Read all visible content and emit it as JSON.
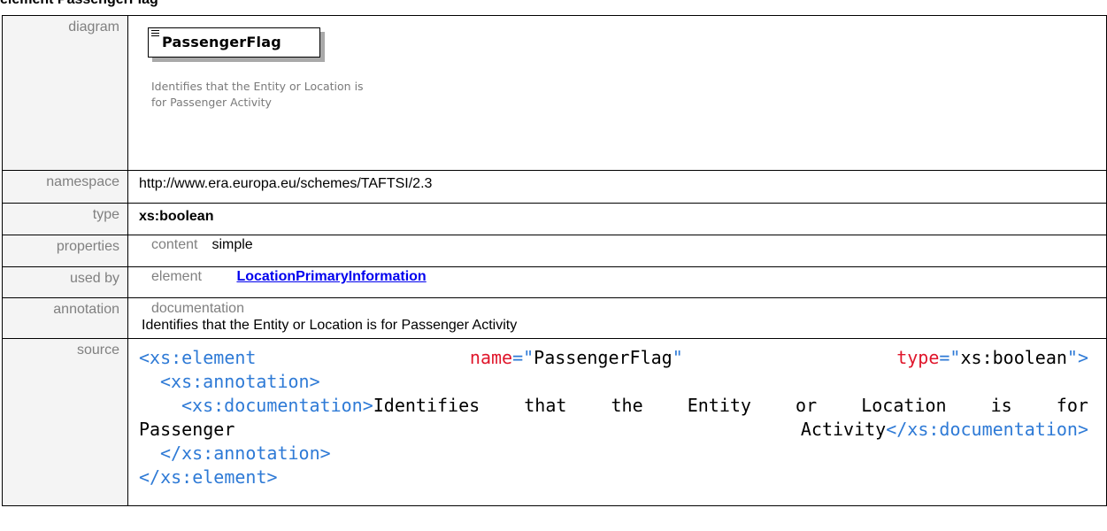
{
  "heading": "element PassengerFlag",
  "diagram": {
    "label": "diagram",
    "element_name": "PassengerFlag",
    "element_doc": "Identifies that the Entity or Location is for Passenger Activity"
  },
  "namespace": {
    "label": "namespace",
    "value": "http://www.era.europa.eu/schemes/TAFTSI/2.3"
  },
  "type": {
    "label": "type",
    "value": "xs:boolean"
  },
  "properties": {
    "label": "properties",
    "key": "content",
    "value": "simple"
  },
  "used_by": {
    "label": "used by",
    "key": "element",
    "link": "LocationPrimaryInformation"
  },
  "annotation": {
    "label": "annotation",
    "key": "documentation",
    "value": "Identifies that the Entity or Location is for Passenger Activity"
  },
  "source": {
    "label": "source",
    "l1_open": "<xs:element",
    "l1_attr1": "name",
    "l1_eq1": "=\"",
    "l1_val1": "PassengerFlag",
    "l1_q1": "\"",
    "l1_attr2": "type",
    "l1_eq2": "=\"",
    "l1_val2": "xs:boolean",
    "l1_close": "\">",
    "l2": "<xs:annotation>",
    "l3_tag": "<xs:documentation>",
    "l3_w1": "Identifies",
    "l3_w2": "that",
    "l3_w3": "the",
    "l3_w4": "Entity",
    "l3_w5": "or",
    "l3_w6": "Location",
    "l3_w7": "is",
    "l3_w8": "for",
    "l4_w1": "Passenger",
    "l4_w2": "Activity",
    "l4_close": "</xs:documentation>",
    "l5": "</xs:annotation>",
    "l6": "</xs:element>"
  }
}
